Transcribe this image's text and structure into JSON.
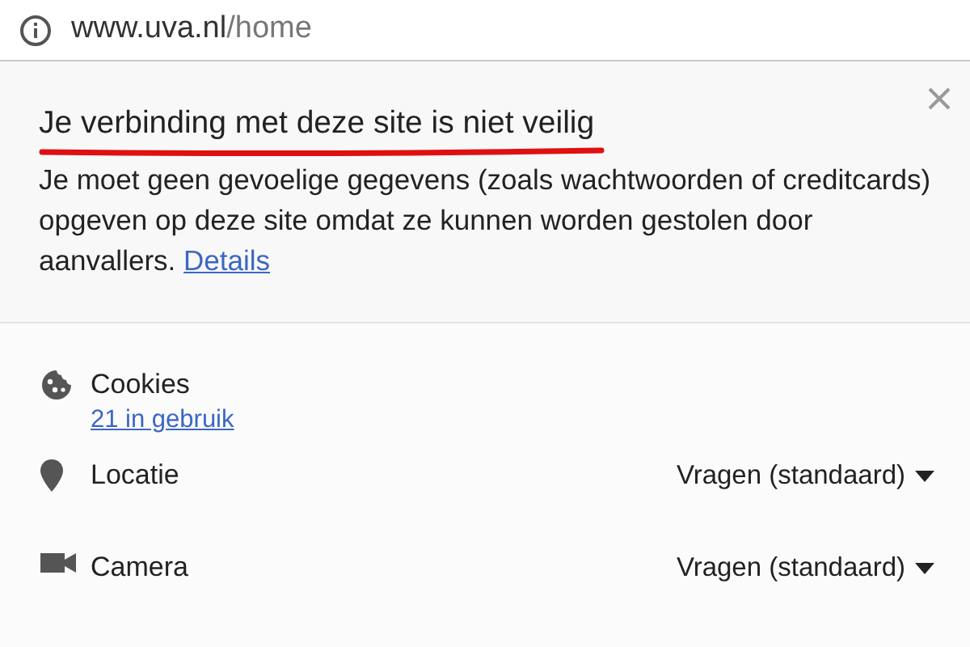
{
  "address_bar": {
    "host": "www.uva.nl",
    "path": "/home"
  },
  "security": {
    "title": "Je verbinding met deze site is niet veilig",
    "body": "Je moet geen gevoelige gegevens (zoals wachtwoorden of creditcards) opgeven op deze site omdat ze kunnen worden gestolen door aanvallers.",
    "link": "Details"
  },
  "permissions": [
    {
      "kind": "cookies",
      "label": "Cookies",
      "link": "21 in gebruik"
    },
    {
      "kind": "location",
      "label": "Locatie",
      "value": "Vragen (standaard)"
    },
    {
      "kind": "camera",
      "label": "Camera",
      "value": "Vragen (standaard)"
    }
  ]
}
